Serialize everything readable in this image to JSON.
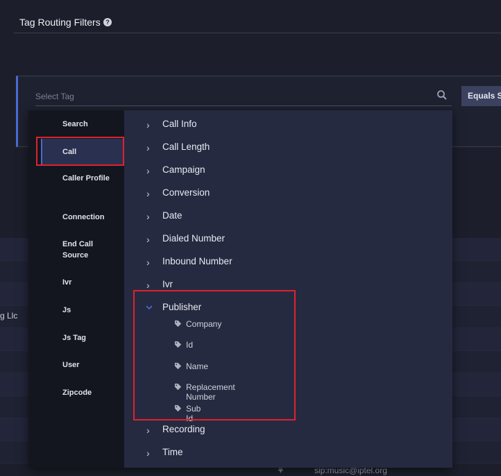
{
  "header": {
    "title": "Tag Routing Filters",
    "help_icon": "question-circle-icon"
  },
  "filter": {
    "select_placeholder": "Select Tag",
    "operator_button": "Equals Sin"
  },
  "background": {
    "partial_text": "g Llc",
    "footer_text": "sip:music@iptel.org",
    "footer_icon": "bot-icon"
  },
  "dropdown": {
    "categories": [
      "Search",
      "Call",
      "Caller Profile",
      "Connection",
      "End Call Source",
      "Ivr",
      "Js",
      "Js Tag",
      "User",
      "Zipcode"
    ],
    "active_category": "Call",
    "tree": [
      {
        "label": "Call Info",
        "expanded": false
      },
      {
        "label": "Call Length",
        "expanded": false
      },
      {
        "label": "Campaign",
        "expanded": false
      },
      {
        "label": "Conversion",
        "expanded": false
      },
      {
        "label": "Date",
        "expanded": false
      },
      {
        "label": "Dialed Number",
        "expanded": false
      },
      {
        "label": "Inbound Number",
        "expanded": false
      },
      {
        "label": "Ivr",
        "expanded": false
      },
      {
        "label": "Publisher",
        "expanded": true,
        "children": [
          "Company",
          "Id",
          "Name",
          "Replacement Number",
          "Sub Id"
        ]
      },
      {
        "label": "Recording",
        "expanded": false
      },
      {
        "label": "Time",
        "expanded": false
      }
    ]
  },
  "colors": {
    "accent": "#4a6bd6",
    "highlight": "#e0222c",
    "panel": "#262a40",
    "sidebar": "#14161f"
  }
}
